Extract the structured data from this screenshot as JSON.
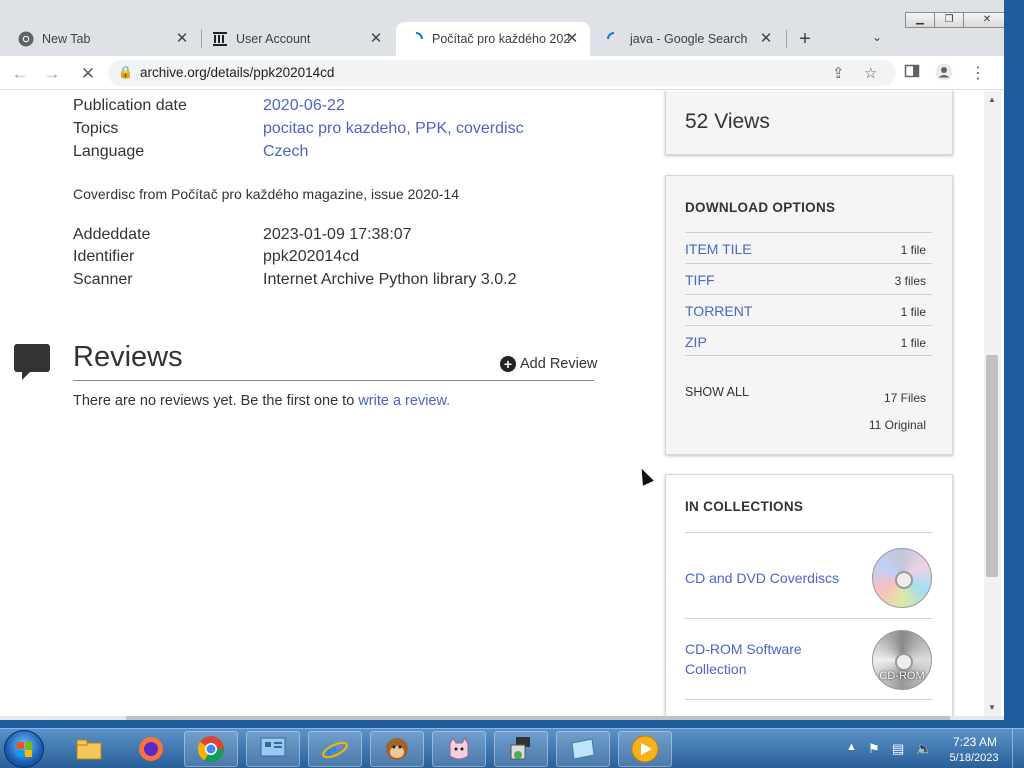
{
  "tabs": [
    {
      "title": "New Tab",
      "icon": "chrome-icon"
    },
    {
      "title": "User Account",
      "icon": "archive-icon"
    },
    {
      "title": "Počítač pro každého 202",
      "icon": "loading-spinner-icon"
    },
    {
      "title": "java - Google Search",
      "icon": "loading-spinner-icon"
    }
  ],
  "tab_close_glyph": "✕",
  "new_tab_glyph": "+",
  "tab_menu_glyph": "⌄",
  "address_bar": {
    "url": "archive.org/details/ppk202014cd"
  },
  "metadata": {
    "publication_date_label": "Publication date",
    "publication_date": "2020-06-22",
    "topics_label": "Topics",
    "topics": "pocitac pro kazdeho, PPK, coverdisc",
    "language_label": "Language",
    "language": "Czech",
    "description": "Coverdisc from Počítač pro každého magazine, issue 2020-14",
    "addeddate_label": "Addeddate",
    "addeddate": "2023-01-09 17:38:07",
    "identifier_label": "Identifier",
    "identifier": "ppk202014cd",
    "scanner_label": "Scanner",
    "scanner": "Internet Archive Python library 3.0.2"
  },
  "reviews": {
    "title": "Reviews",
    "add_review": "Add Review",
    "empty_text": "There are no reviews yet. Be the first one to ",
    "write_link": "write a review."
  },
  "views": {
    "text": "52 Views"
  },
  "download_options": {
    "heading": "DOWNLOAD OPTIONS",
    "items": [
      {
        "label": "ITEM TILE",
        "count": "1 file"
      },
      {
        "label": "TIFF",
        "count": "3 files"
      },
      {
        "label": "TORRENT",
        "count": "1 file"
      },
      {
        "label": "ZIP",
        "count": "1 file"
      }
    ],
    "show_all": "SHOW ALL",
    "total_files": "17 Files",
    "original_files": "11 Original"
  },
  "collections": {
    "heading": "IN COLLECTIONS",
    "items": [
      {
        "label": "CD and DVD Coverdiscs"
      },
      {
        "label": "CD-ROM Software Collection",
        "image_caption": "CD-ROM"
      }
    ]
  },
  "taskbar": {
    "apps": [
      "explorer-icon",
      "firefox-icon",
      "chrome-icon",
      "control-panel-icon",
      "internet-explorer-icon",
      "monkey-icon",
      "cat-icon",
      "installer-icon",
      "notepad-icon",
      "media-player-icon"
    ],
    "clock_time": "7:23 AM",
    "clock_date": "5/18/2023"
  },
  "colors": {
    "link": "#4b64c8",
    "taskbar": "#2a5f98"
  }
}
